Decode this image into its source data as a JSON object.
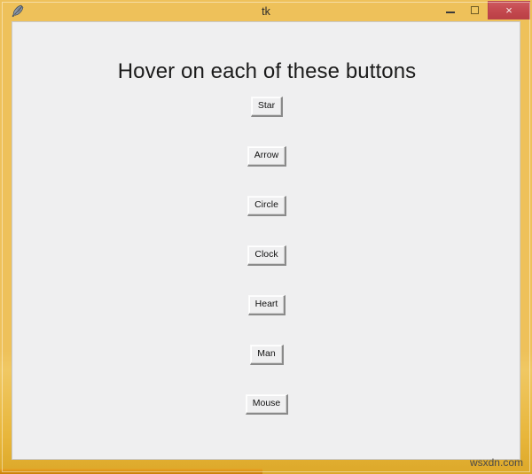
{
  "window": {
    "title": "tk",
    "app_icon": "feather-icon",
    "frame_color": "#eec15a",
    "client_bg": "#efeff0",
    "controls": {
      "minimize_label": "—",
      "maximize_label": "□",
      "close_label": "×",
      "close_color": "#c4494f"
    }
  },
  "content": {
    "heading": "Hover on each of these buttons",
    "buttons": [
      {
        "label": "Star"
      },
      {
        "label": "Arrow"
      },
      {
        "label": "Circle"
      },
      {
        "label": "Clock"
      },
      {
        "label": "Heart"
      },
      {
        "label": "Man"
      },
      {
        "label": "Mouse"
      }
    ]
  },
  "watermark": {
    "text": "wsxdn.com"
  }
}
